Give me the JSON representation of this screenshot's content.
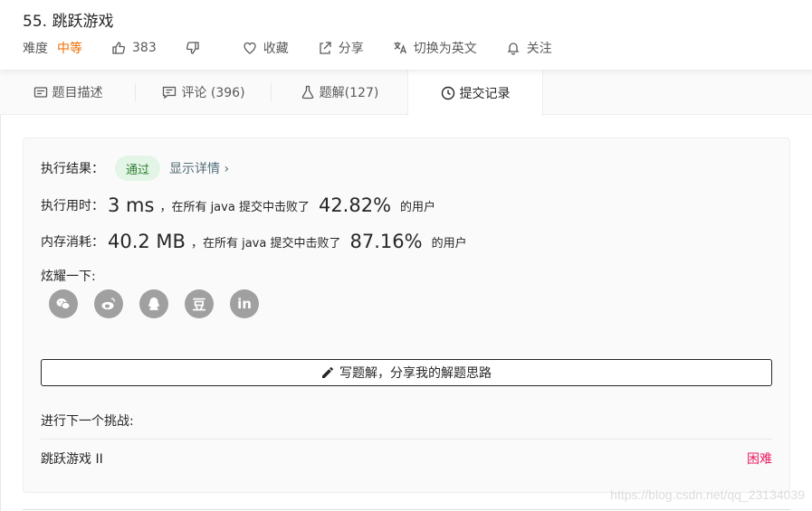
{
  "problem": {
    "title": "55. 跳跃游戏"
  },
  "meta": {
    "difficulty_label": "难度",
    "difficulty": "中等",
    "likes": "383",
    "collect": "收藏",
    "share": "分享",
    "switch_lang": "切换为英文",
    "follow": "关注"
  },
  "tabs": [
    {
      "label": "题目描述",
      "icon": "description-icon"
    },
    {
      "label": "评论 (396)",
      "icon": "comment-icon"
    },
    {
      "label": "题解(127)",
      "icon": "flask-icon"
    },
    {
      "label": "提交记录",
      "icon": "clock-icon",
      "active": true
    }
  ],
  "result": {
    "label": "执行结果：",
    "status": "通过",
    "detail_link": "显示详情 ›"
  },
  "runtime": {
    "label": "执行用时：",
    "value": "3 ms",
    "middle": "，在所有 java 提交中击败了",
    "percent": "42.82%",
    "suffix": "的用户"
  },
  "memory": {
    "label": "内存消耗：",
    "value": "40.2 MB",
    "middle": "，在所有 java 提交中击败了",
    "percent": "87.16%",
    "suffix": "的用户"
  },
  "share_section": {
    "label": "炫耀一下:",
    "icons": [
      "wechat-icon",
      "weibo-icon",
      "qq-icon",
      "douban-icon",
      "linkedin-icon"
    ],
    "douban_glyph": "豆",
    "linkedin_glyph": "in"
  },
  "write_solution": "写题解，分享我的解题思路",
  "next": {
    "label": "进行下一个挑战:",
    "problem": "跳跃游戏 II",
    "difficulty": "困难"
  },
  "watermark": "https://blog.csdn.net/qq_23134039",
  "colors": {
    "medium": "#ef6c00",
    "hard": "#e91e63",
    "pass_bg": "#e3f5e6",
    "pass_text": "#2e7d32",
    "link": "#546e7a"
  }
}
